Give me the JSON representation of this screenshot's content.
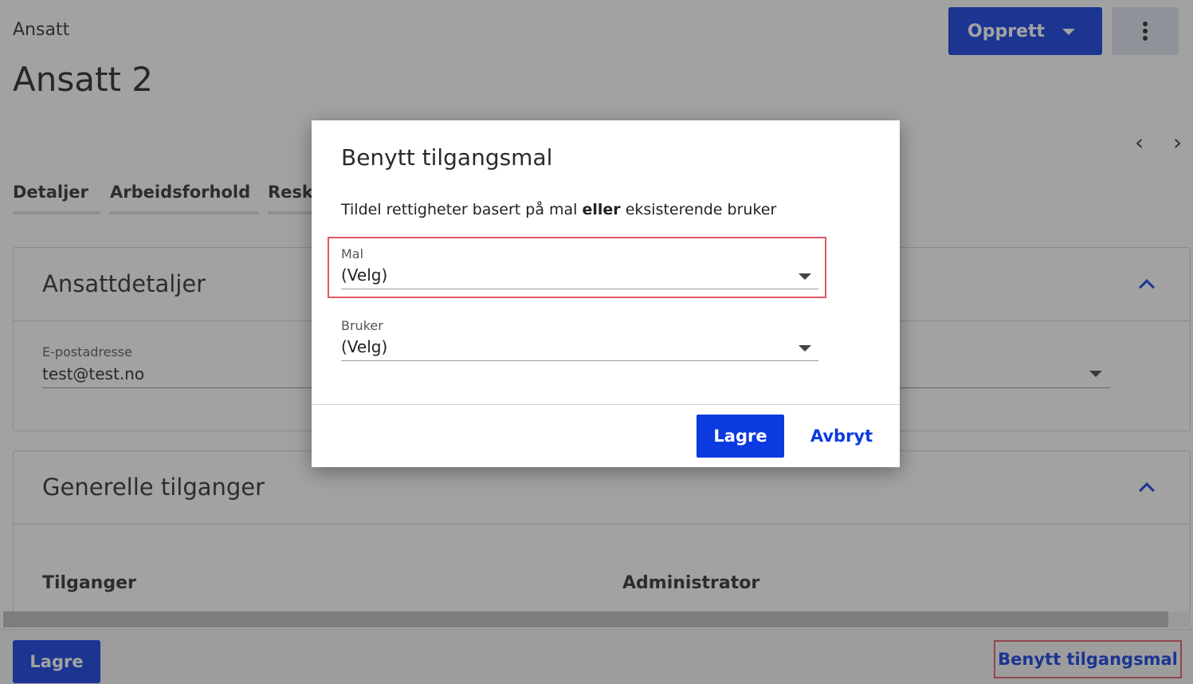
{
  "header": {
    "breadcrumb": "Ansatt",
    "title": "Ansatt 2",
    "create_label": "Opprett",
    "prev_icon": "‹",
    "next_icon": "›"
  },
  "tabs": [
    "Detaljer",
    "Arbeidsforhold",
    "Reske"
  ],
  "employee_details": {
    "title": "Ansattdetaljer",
    "email_label": "E-postadresse",
    "email_value": "test@test.no"
  },
  "general_access": {
    "title": "Generelle tilganger",
    "col_access": "Tilganger",
    "col_admin": "Administrator"
  },
  "footer": {
    "save_label": "Lagre",
    "apply_template_label": "Benytt tilgangsmal"
  },
  "modal": {
    "title": "Benytt tilgangsmal",
    "desc_before": "Tildel rettigheter basert på mal ",
    "desc_bold": "eller",
    "desc_after": " eksisterende bruker",
    "template_label": "Mal",
    "template_value": "(Velg)",
    "user_label": "Bruker",
    "user_value": "(Velg)",
    "save_label": "Lagre",
    "cancel_label": "Avbryt"
  },
  "colors": {
    "primary": "#0a3ae0",
    "highlight": "#e05a6a"
  }
}
